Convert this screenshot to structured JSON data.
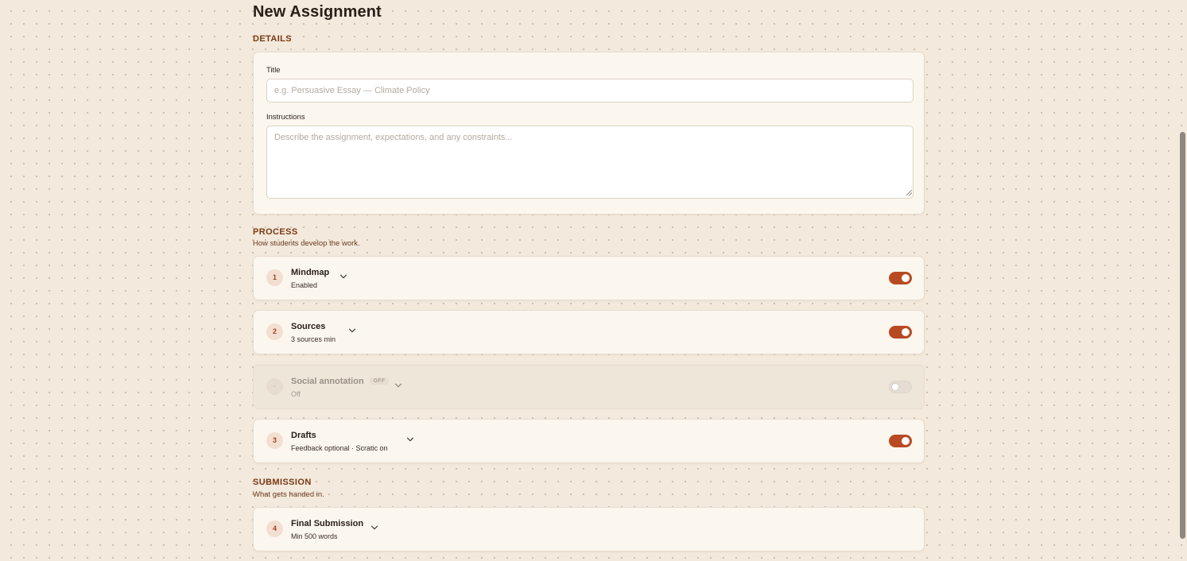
{
  "page": {
    "title": "New Assignment"
  },
  "details": {
    "section_label": "DETAILS",
    "title_field": {
      "label": "Title",
      "value": "",
      "placeholder": "e.g. Persuasive Essay — Climate Policy"
    },
    "instructions_field": {
      "label": "Instructions",
      "value": "",
      "placeholder": "Describe the assignment, expectations, and any constraints..."
    }
  },
  "process": {
    "section_label": "PROCESS",
    "subtitle": "How students develop the work.",
    "steps": [
      {
        "number": "1",
        "title": "Mindmap",
        "subtitle": "Enabled",
        "enabled": true,
        "icon": "chevron-down-icon"
      },
      {
        "number": "2",
        "title": "Sources",
        "subtitle": "3 sources min",
        "enabled": true,
        "icon": "chevron-down-icon"
      },
      {
        "number": "·",
        "title": "Social annotation",
        "badge": "OFF",
        "subtitle": "Off",
        "enabled": false,
        "icon": "chevron-down-icon"
      },
      {
        "number": "3",
        "title": "Drafts",
        "subtitle": "Feedback optional · Scratic on",
        "enabled": true,
        "icon": "chevron-down-icon"
      }
    ]
  },
  "submission": {
    "section_label": "SUBMISSION",
    "subtitle": "What gets handed in.",
    "steps": [
      {
        "number": "4",
        "title": "Final Submission",
        "subtitle": "Min 500 words",
        "icon": "chevron-down-icon"
      }
    ]
  },
  "colors": {
    "background": "#f3e9dc",
    "card": "#fbf6ee",
    "accent": "#b84a22",
    "section_label": "#7a3a16",
    "toggle_off": "#e5ddd3"
  }
}
